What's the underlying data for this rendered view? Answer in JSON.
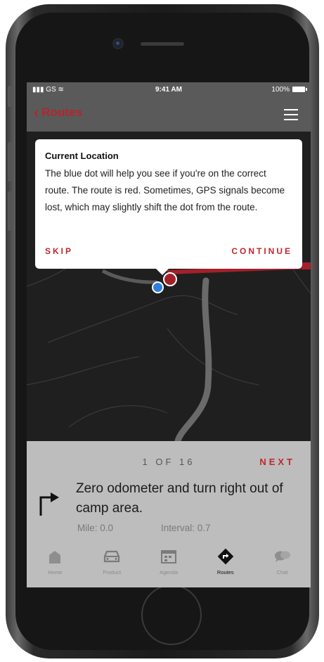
{
  "status": {
    "carrier": "GS",
    "time": "9:41 AM",
    "battery": "100%"
  },
  "nav": {
    "back_label": "Routes",
    "menu_icon": "list-icon"
  },
  "tooltip": {
    "title": "Current Location",
    "body": "The blue dot will help you see if you're on the correct route. The route is red. Sometimes, GPS signals become lost, which may slightly shift the dot from the route.",
    "skip_label": "SKIP",
    "continue_label": "CONTINUE"
  },
  "map": {
    "route_color": "#a3202a",
    "location_color": "#2f7fe0"
  },
  "instruction": {
    "pager": "1 OF 16",
    "next_label": "NEXT",
    "text": "Zero odometer and turn right out of camp area.",
    "mile": "Mile: 0.0",
    "interval": "Interval: 0.7"
  },
  "tabs": [
    {
      "label": "Home",
      "icon": "home-icon",
      "active": false
    },
    {
      "label": "Product",
      "icon": "car-icon",
      "active": false
    },
    {
      "label": "Agenda",
      "icon": "calendar-icon",
      "active": false
    },
    {
      "label": "Routes",
      "icon": "route-sign-icon",
      "active": true
    },
    {
      "label": "Chat",
      "icon": "chat-icon",
      "active": false
    }
  ]
}
